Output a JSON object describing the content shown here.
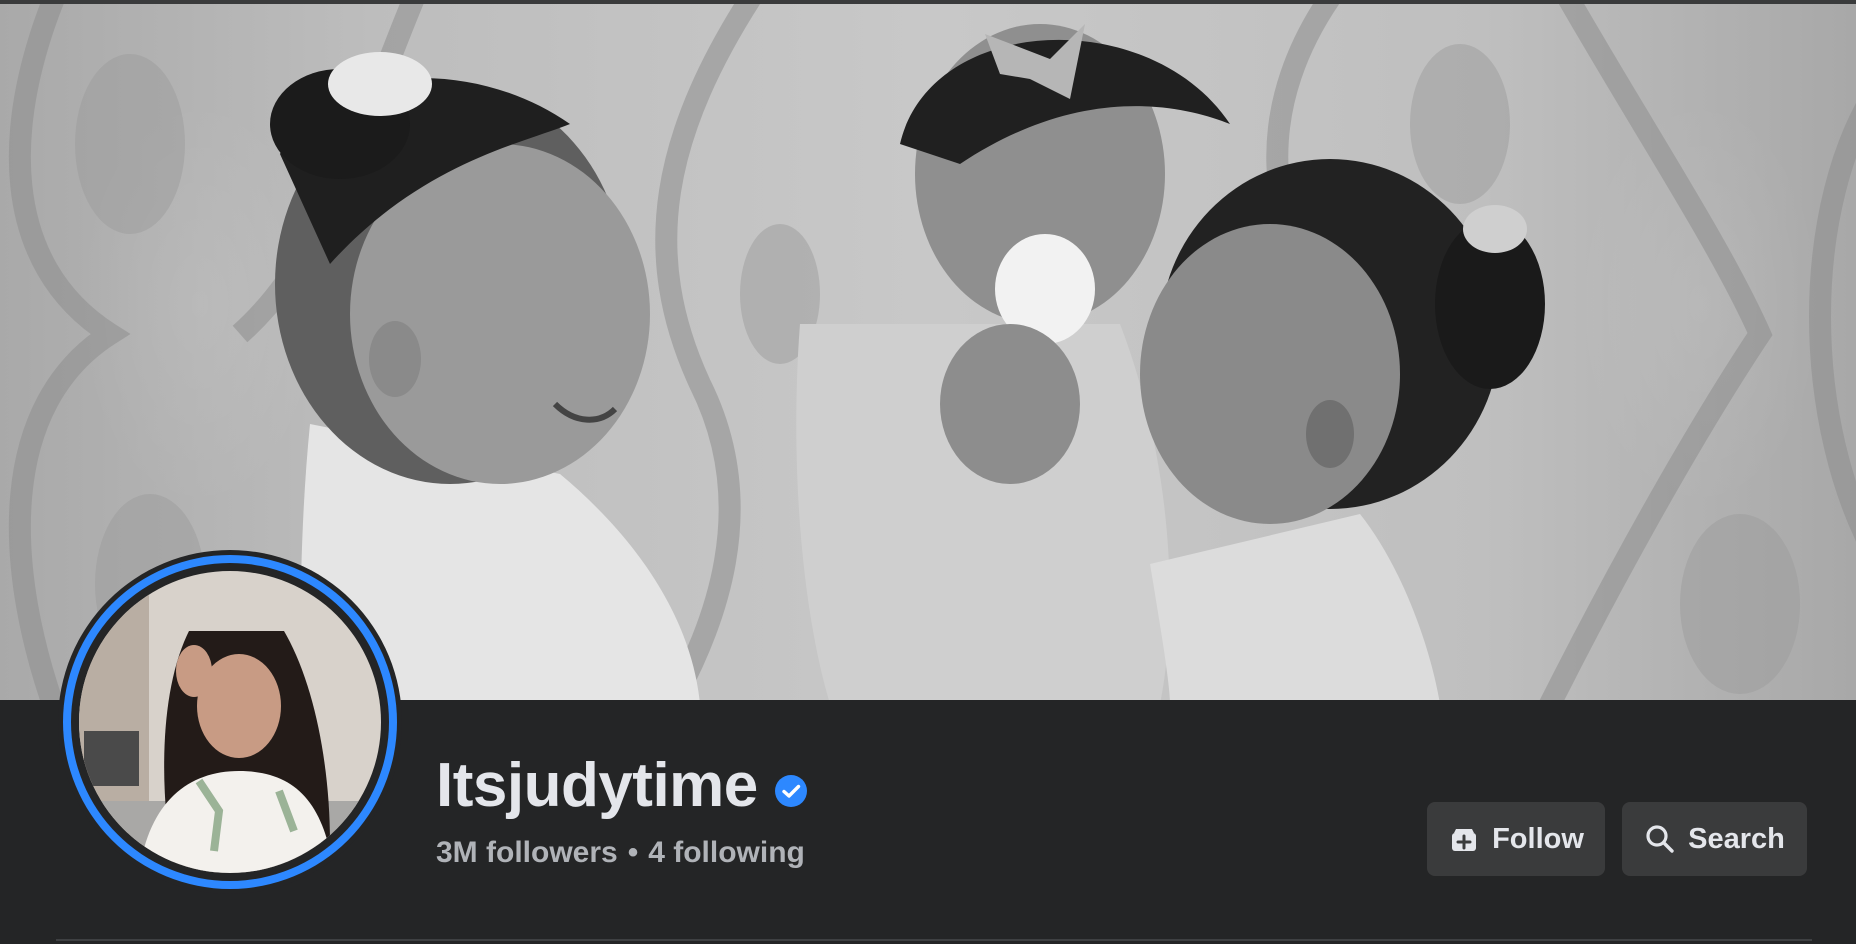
{
  "profile": {
    "name": "Itsjudytime",
    "verified": true,
    "followers_text": "3M followers",
    "separator": "•",
    "following_text": "4 following"
  },
  "actions": {
    "follow_label": "Follow",
    "search_label": "Search"
  },
  "icons": {
    "verified": "verified-badge-icon",
    "follow": "follow-plus-icon",
    "search": "search-icon"
  },
  "colors": {
    "background": "#242526",
    "text_primary": "#e4e6eb",
    "text_secondary": "#b0b3b8",
    "button_bg": "#3a3b3c",
    "accent": "#2d88ff"
  }
}
